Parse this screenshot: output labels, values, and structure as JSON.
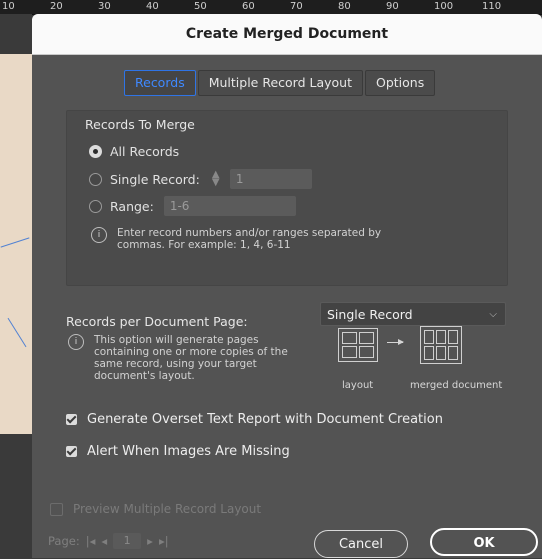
{
  "ruler": [
    "10",
    "20",
    "30",
    "40",
    "50",
    "60",
    "70",
    "80",
    "90",
    "100",
    "110"
  ],
  "dialog": {
    "title": "Create Merged Document",
    "tabs": [
      {
        "label": "Records",
        "active": true
      },
      {
        "label": "Multiple Record Layout",
        "active": false
      },
      {
        "label": "Options",
        "active": false
      }
    ]
  },
  "records_to_merge": {
    "title": "Records To Merge",
    "all_records": "All Records",
    "single_record": "Single Record:",
    "single_record_value": "1",
    "range": "Range:",
    "range_value": "1-6",
    "hint": "Enter record numbers and/or ranges separated by commas. For example: 1, 4, 6-11"
  },
  "records_per_page": {
    "label": "Records per Document Page:",
    "selected": "Single Record",
    "hint": "This option will generate pages containing one or more copies of the same record, using your target document's layout.",
    "layout_caption": "layout",
    "merged_caption": "merged document"
  },
  "checkboxes": {
    "overset": {
      "label": "Generate Overset Text Report with Document Creation",
      "checked": true
    },
    "images": {
      "label": "Alert When Images Are Missing",
      "checked": true
    }
  },
  "preview": {
    "label": "Preview Multiple Record Layout",
    "page_label": "Page:",
    "page_value": "1"
  },
  "buttons": {
    "cancel": "Cancel",
    "ok": "OK"
  },
  "icons": {
    "info": "info-icon",
    "dropdown": "chevron-down-icon",
    "stepper": "stepper-icon"
  },
  "colors": {
    "accent": "#3f89ff",
    "dialog_bg": "#535353",
    "title_bg": "#fafafa"
  }
}
